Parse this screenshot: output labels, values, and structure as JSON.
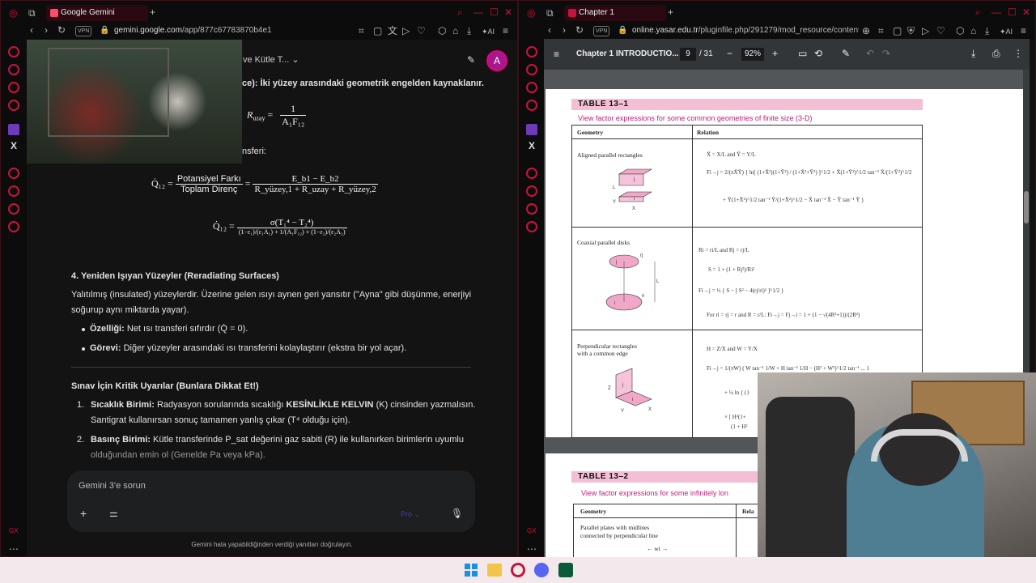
{
  "left_window": {
    "tab_title": "Google Gemini",
    "url_domain": "gemini.google.com",
    "url_path": "/app/877c67783870b4e1",
    "vpn_label": "VPN",
    "ai_label": "AI",
    "conversation_title": "si ve Kütle T...",
    "avatar_letter": "A",
    "content": {
      "line_surface_res": "ce): İki yüzey arasındaki geometrik engelden kaynaklanır.",
      "r_space_lhs": "R",
      "r_space_sub": "uzay",
      "r_space_num": "1",
      "r_space_den": "A₁F₁₂",
      "line_transfer": "nsferi:",
      "eq1_lhs": "Q̇₁₂ =",
      "eq1_num": "Potansiyel Farkı",
      "eq1_den": "Toplam Direnç",
      "eq1_num2": "E_b1 − E_b2",
      "eq1_den2": "R_yüzey,1 + R_uzay + R_yüzey,2",
      "eq2_lhs": "Q̇₁₂ =",
      "eq2_num": "σ(T₁⁴ − T₂⁴)",
      "eq2_den": "(1−ε₁)/(ε₁A₁) + 1/(A₁F₁₂) + (1−ε₂)/(ε₂A₂)",
      "section4_title": "4. Yeniden Işıyan Yüzeyler (Reradiating Surfaces)",
      "section4_p1": "Yalıtılmış (insulated) yüzeylerdir. Üzerine gelen ısıyı aynen geri yansıtır (\"Ayna\" gibi düşünme, enerjiyi",
      "section4_p2": "soğurup aynı miktarda yayar).",
      "b1_label": "Özelliği:",
      "b1_text": "Net ısı transferi sıfırdır (Q̇ = 0).",
      "b2_label": "Görevi:",
      "b2_text": "Diğer yüzeyler arasındaki ısı transferini kolaylaştırır (ekstra bir yol açar).",
      "warn_title": "Sınav İçin Kritik Uyarılar (Bunlara Dikkat Et!)",
      "w1_num": "1.",
      "w1_label": "Sıcaklık Birimi:",
      "w1_text_a": "Radyasyon sorularında sıcaklığı",
      "w1_bold": "KESİNLİKLE KELVIN",
      "w1_text_b": "(K) cinsinden yazmalısın.",
      "w1_line2": "Santigrat kullanırsan sonuç tamamen yanlış çıkar (T⁴ olduğu için).",
      "w2_num": "2.",
      "w2_label": "Basınç Birimi:",
      "w2_text": "Kütle transferinde P_sat değerini gaz sabiti (R) ile kullanırken birimlerin uyumlu",
      "w2_line2": "olduğundan emin ol (Genelde Pa veya kPa)."
    },
    "input_placeholder": "Gemini 3'e sorun",
    "model_label": "Pro",
    "footer_note": "Gemini hata yapabildiğinden verdiği yanıtları doğrulayın."
  },
  "right_window": {
    "tab_title": "Chapter 1 INTRODUCTIO",
    "url_domain": "online.yasar.edu.tr",
    "url_path": "/pluginfile.php/291279/mod_resource/content/1/",
    "vpn_label": "VPN",
    "ai_label": "AI",
    "pdf": {
      "doc_title": "Chapter 1 INTRODUCTIO...",
      "page_current": "9",
      "page_total": "/ 31",
      "zoom": "92%",
      "table1_title": "TABLE 13–1",
      "table1_subtitle": "View factor expressions for some common geometries of finite size (3-D)",
      "col_geometry": "Geometry",
      "col_relation": "Relation",
      "row1_name": "Aligned parallel rectangles",
      "row1_f1": "X̄ = X/L and Ȳ = Y/L",
      "row1_f2": "Fi→j = 2/(πX̄Ȳ) { ln[ (1+X̄²)(1+Ȳ²) / (1+X̄²+Ȳ²) ]^1/2 + X̄(1+Ȳ²)^1/2 tan⁻¹ X̄/(1+Ȳ²)^1/2",
      "row1_f3": "+ Ȳ(1+X̄²)^1/2 tan⁻¹ Ȳ/(1+X̄²)^1/2 − X̄ tan⁻¹ X̄ − Ȳ tan⁻¹ Ȳ }",
      "row2_name": "Coaxial parallel disks",
      "row2_f1": "Ri = ri/L and Rj = rj/L",
      "row2_f2": "S = 1 + (1 + Rj²)/Ri²",
      "row2_f3": "Fi→j = ½ { S − [ S² − 4(rj/ri)² ]^1/2 }",
      "row2_f4": "For ri = rj = r and R = r/L:    Fi→j = Fj→i = 1 + (1 − √(4R²+1))/(2R²)",
      "row3_name": "Perpendicular rectangles",
      "row3_name2": "with a common edge",
      "row3_f1": "H = Z/X and W = Y/X",
      "row3_f2": "Fi→j = 1/(πW) ( W tan⁻¹ 1/W + H tan⁻¹ 1/H − (H² + W²)^1/2 tan⁻¹ ... 1",
      "row3_f3": "+ ¼ ln { (1",
      "row3_f4": "× [ H²(1+",
      "row3_f5": "(1 + H²",
      "table2_title": "TABLE 13–2",
      "table2_subtitle": "View factor expressions for some infinitely lon",
      "t2_col_geometry": "Geometry",
      "t2_col_relation": "Rela",
      "t2_row1": "Parallel plates with midlines",
      "t2_row1b": "connected by perpendicular line",
      "lbl_i": "i",
      "lbl_j": "j",
      "lbl_L": "L",
      "lbl_X": "X",
      "lbl_Y": "Y",
      "lbl_Z": "Z",
      "lbl_ri": "ri",
      "lbl_rj": "rj",
      "lbl_wi": "wi"
    }
  },
  "colors": {
    "accent": "#c8143c",
    "table_header": "#f4bfd5",
    "table_subtitle": "#c0207a",
    "avatar": "#a4198c"
  }
}
